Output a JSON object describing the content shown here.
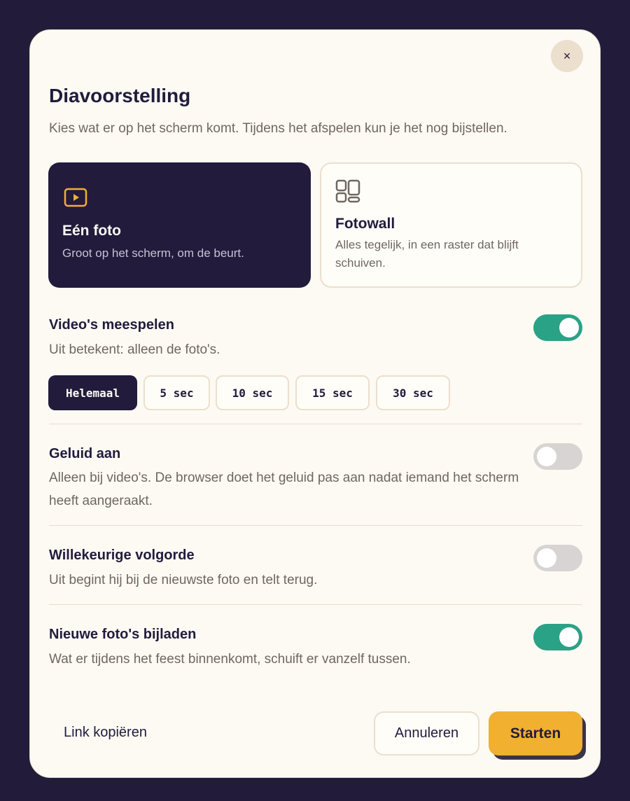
{
  "dialog": {
    "title": "Diavoorstelling",
    "subtitle": "Kies wat er op het scherm komt. Tijdens het afspelen kun je het nog bijstellen.",
    "close_label": "×"
  },
  "modes": [
    {
      "title": "Eén foto",
      "description": "Groot op het scherm, om de beurt.",
      "icon": "play-icon",
      "selected": true
    },
    {
      "title": "Fotowall",
      "description": "Alles tegelijk, in een raster dat blijft schuiven.",
      "icon": "grid-icon",
      "selected": false
    }
  ],
  "settings": {
    "videos": {
      "title": "Video's meespelen",
      "description": "Uit betekent: alleen de foto's.",
      "enabled": true
    },
    "sound": {
      "title": "Geluid aan",
      "description": "Alleen bij video's. De browser doet het geluid pas aan nadat iemand het scherm heeft aangeraakt.",
      "enabled": false
    },
    "shuffle": {
      "title": "Willekeurige volgorde",
      "description": "Uit begint hij bij de nieuwste foto en telt terug.",
      "enabled": false
    },
    "reload": {
      "title": "Nieuwe foto's bijladen",
      "description": "Wat er tijdens het feest binnenkomt, schuift er vanzelf tussen.",
      "enabled": true
    }
  },
  "video_durations": {
    "options": [
      "Helemaal",
      "5 sec",
      "10 sec",
      "15 sec",
      "30 sec"
    ],
    "selected": "Helemaal"
  },
  "footer": {
    "copy_link": "Link kopiëren",
    "cancel": "Annuleren",
    "start": "Starten"
  },
  "colors": {
    "backdrop": "#221c3a",
    "modal": "#fdfaf4",
    "dark": "#221b3b",
    "toggle_on": "#2aa286",
    "toggle_off": "#d8d4d3",
    "accent": "#f2b031"
  }
}
